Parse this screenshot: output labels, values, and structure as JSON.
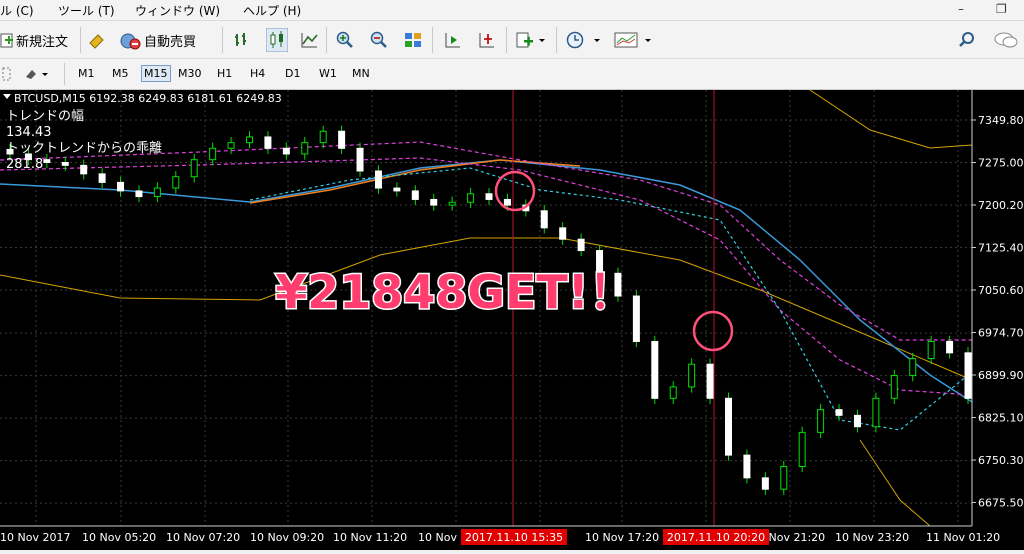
{
  "menu": [
    {
      "label": "ル (C)"
    },
    {
      "label": "ツール (T)"
    },
    {
      "label": "ウィンドウ (W)"
    },
    {
      "label": "ヘルプ (H)"
    }
  ],
  "window_controls": {
    "minimize": "–",
    "restore": "❐"
  },
  "toolbar": {
    "new_order_label": "新規注文",
    "auto_trade_label": "自動売買"
  },
  "timeframes": [
    "M1",
    "M5",
    "M15",
    "M30",
    "H1",
    "H4",
    "D1",
    "W1",
    "MN"
  ],
  "active_timeframe": "M15",
  "chart": {
    "header": "BTCUSD,M15  6192.38 6249.83 6181.61 6249.83",
    "indicator_lines": [
      "トレンドの幅",
      "134.43",
      "トックトレンドからの乖離",
      "281.8"
    ],
    "annotation": "¥21848GET!！",
    "annotation_color": "#ff3d6e",
    "marker_color": "#ff4f7b",
    "vline_color": "#c8102e",
    "price_labels": [
      "7349.80",
      "7275.00",
      "7200.20",
      "7125.40",
      "7050.60",
      "6974.70",
      "6899.90",
      "6825.10",
      "6750.30",
      "6675.50"
    ],
    "time_labels": [
      "10 Nov 2017",
      "10 Nov 05:20",
      "10 Nov 07:20",
      "10 Nov 09:20",
      "10 Nov 11:20",
      "10 Nov",
      "10 Nov 17:20",
      "10 Nov 21:20",
      "10 Nov 23:20",
      "11 Nov 01:20"
    ],
    "highlight_times": [
      "2017.11.10 15:35",
      "2017.11.10 20:20"
    ]
  },
  "chart_data": {
    "type": "line",
    "title": "BTCUSD,M15",
    "ohlc_header": {
      "open": 6192.38,
      "high": 6249.83,
      "low": 6181.61,
      "close": 6249.83
    },
    "y_ticks": [
      7349.8,
      7275.0,
      7200.2,
      7125.4,
      7050.6,
      6974.7,
      6899.9,
      6825.1,
      6750.3,
      6675.5
    ],
    "x_ticks": [
      "10 Nov 2017",
      "10 Nov 05:20",
      "10 Nov 07:20",
      "10 Nov 09:20",
      "10 Nov 11:20",
      "10 Nov",
      "10 Nov 17:20",
      "10 Nov 21:20",
      "10 Nov 23:20",
      "11 Nov 01:20"
    ],
    "closes": [
      7290,
      7280,
      7275,
      7270,
      7255,
      7240,
      7225,
      7215,
      7230,
      7250,
      7280,
      7300,
      7310,
      7320,
      7300,
      7290,
      7310,
      7330,
      7300,
      7260,
      7230,
      7225,
      7210,
      7200,
      7205,
      7220,
      7210,
      7200,
      7190,
      7160,
      7140,
      7120,
      7080,
      7040,
      6960,
      6860,
      6880,
      6920,
      6860,
      6760,
      6720,
      6700,
      6740,
      6800,
      6840,
      6830,
      6810,
      6860,
      6900,
      6930,
      6960,
      6940,
      6860
    ]
  }
}
